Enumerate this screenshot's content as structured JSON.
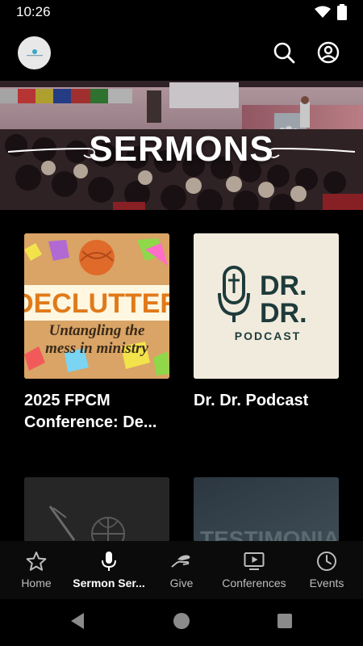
{
  "status": {
    "time": "10:26"
  },
  "header": {
    "logo_icon": "church-logo-icon",
    "search_icon": "search-icon",
    "account_icon": "account-icon"
  },
  "hero": {
    "title": "SERMONS"
  },
  "cards": [
    {
      "title": "2025 FPCM Conference: De...",
      "art_heading": "DECLUTTER",
      "art_subtitle_1": "Untangling the",
      "art_subtitle_2": "mess in ministry"
    },
    {
      "title": "Dr. Dr. Podcast",
      "art_heading_1": "DR.",
      "art_heading_2": "DR.",
      "art_subtitle": "PODCAST"
    },
    {
      "title": "",
      "art_heading": ""
    },
    {
      "title": "",
      "art_heading": "TESTIMONIALS"
    }
  ],
  "nav": {
    "items": [
      {
        "label": "Home",
        "icon": "star-icon"
      },
      {
        "label": "Sermon Ser...",
        "icon": "microphone-icon"
      },
      {
        "label": "Give",
        "icon": "giving-hand-icon"
      },
      {
        "label": "Conferences",
        "icon": "video-play-icon"
      },
      {
        "label": "Events",
        "icon": "clock-icon"
      }
    ],
    "active_index": 1
  },
  "colors": {
    "background": "#000000",
    "accent_text": "#ffffff",
    "inactive_text": "#bdbdbd",
    "declutter_bg": "#d9a466",
    "podcast_bg": "#f1ebdd",
    "podcast_ink": "#1e3b3b"
  }
}
